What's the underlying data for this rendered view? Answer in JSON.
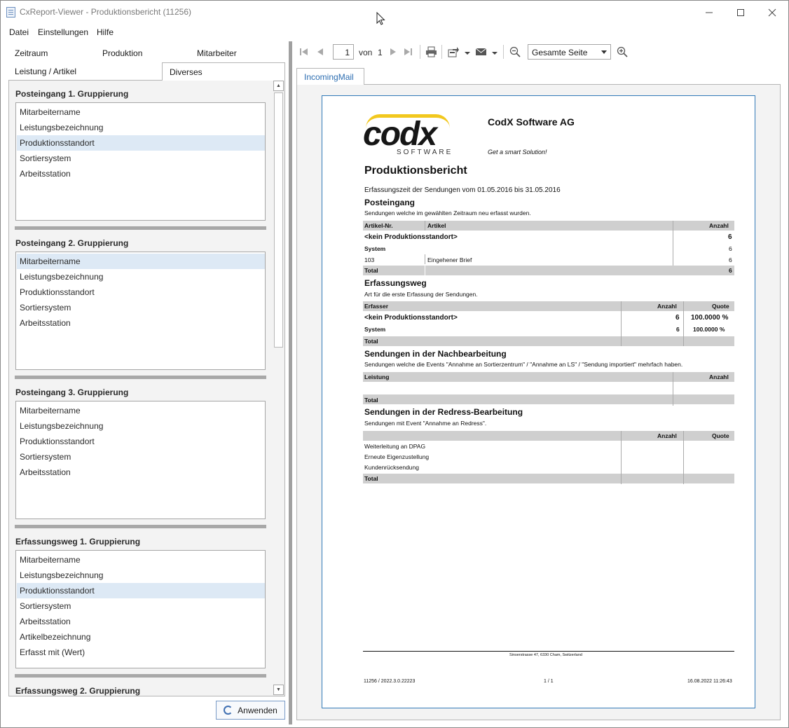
{
  "window": {
    "title": "CxReport-Viewer - Produktionsbericht (11256)"
  },
  "menu": [
    "Datei",
    "Einstellungen",
    "Hilfe"
  ],
  "tabs": {
    "row1": [
      "Zeitraum",
      "Produktion",
      "Mitarbeiter"
    ],
    "row2": [
      "Leistung / Artikel",
      "Diverses"
    ],
    "active": "Diverses"
  },
  "groups": [
    {
      "title": "Posteingang 1. Gruppierung",
      "items": [
        "Mitarbeitername",
        "Leistungsbezeichnung",
        "Produktionsstandort",
        "Sortiersystem",
        "Arbeitsstation"
      ],
      "selected": "Produktionsstandort"
    },
    {
      "title": "Posteingang 2. Gruppierung",
      "items": [
        "Mitarbeitername",
        "Leistungsbezeichnung",
        "Produktionsstandort",
        "Sortiersystem",
        "Arbeitsstation"
      ],
      "selected": "Mitarbeitername"
    },
    {
      "title": "Posteingang 3. Gruppierung",
      "items": [
        "Mitarbeitername",
        "Leistungsbezeichnung",
        "Produktionsstandort",
        "Sortiersystem",
        "Arbeitsstation"
      ],
      "selected": ""
    },
    {
      "title": "Erfassungsweg 1. Gruppierung",
      "items": [
        "Mitarbeitername",
        "Leistungsbezeichnung",
        "Produktionsstandort",
        "Sortiersystem",
        "Arbeitsstation",
        "Artikelbezeichnung",
        "Erfasst mit (Wert)"
      ],
      "selected": "Produktionsstandort"
    },
    {
      "title": "Erfassungsweg 2. Gruppierung",
      "items": [],
      "selected": ""
    }
  ],
  "apply_button": "Anwenden",
  "toolbar": {
    "page": "1",
    "of_label": "von",
    "total_pages": "1",
    "zoom": "Gesamte Seite"
  },
  "report_tab": "IncomingMail",
  "report": {
    "logo_text": "codx",
    "logo_sub": "SOFTWARE",
    "company": "CodX Software AG",
    "slogan": "Get a smart Solution!",
    "title": "Produktionsbericht",
    "period": "Erfassungszeit der Sendungen vom 01.05.2016 bis 31.05.2016",
    "s1": {
      "heading": "Posteingang",
      "desc": "Sendungen welche im gewählten Zeitraum neu erfasst wurden.",
      "headers": [
        "Artikel-Nr.",
        "Artikel",
        "Anzahl"
      ],
      "rows": [
        [
          "<kein Produktionsstandort>",
          "",
          "6"
        ],
        [
          "System",
          "",
          "6"
        ],
        [
          "103",
          "Eingehener Brief",
          "6"
        ]
      ],
      "total": [
        "Total",
        "6"
      ]
    },
    "s2": {
      "heading": "Erfassungsweg",
      "desc": "Art für die erste Erfassung der Sendungen.",
      "headers": [
        "Erfasser",
        "Anzahl",
        "Quote"
      ],
      "rows": [
        [
          "<kein Produktionsstandort>",
          "6",
          "100.0000 %"
        ],
        [
          "System",
          "6",
          "100.0000 %"
        ]
      ],
      "total": "Total"
    },
    "s3": {
      "heading": "Sendungen in der Nachbearbeitung",
      "desc": "Sendungen welche die Events \"Annahme an Sortierzentrum\" / \"Annahme an LS\" / \"Sendung importiert\" mehrfach haben.",
      "headers": [
        "Leistung",
        "Anzahl"
      ],
      "total": "Total"
    },
    "s4": {
      "heading": "Sendungen in der Redress-Bearbeitung",
      "desc": "Sendungen mit Event \"Annahme an Redress\".",
      "headers": [
        "Anzahl",
        "Quote"
      ],
      "rows": [
        "Weiterleitung an DPAG",
        "Erneute Eigenzustellung",
        "Kundenrücksendung"
      ],
      "total": "Total"
    },
    "address": "Sinserstrasse 47,  6330 Cham,  Switzerland",
    "footer_left": "11256 / 2022.3.0.22223",
    "footer_mid": "1 / 1",
    "footer_right": "16.08.2022 11:26:43"
  }
}
